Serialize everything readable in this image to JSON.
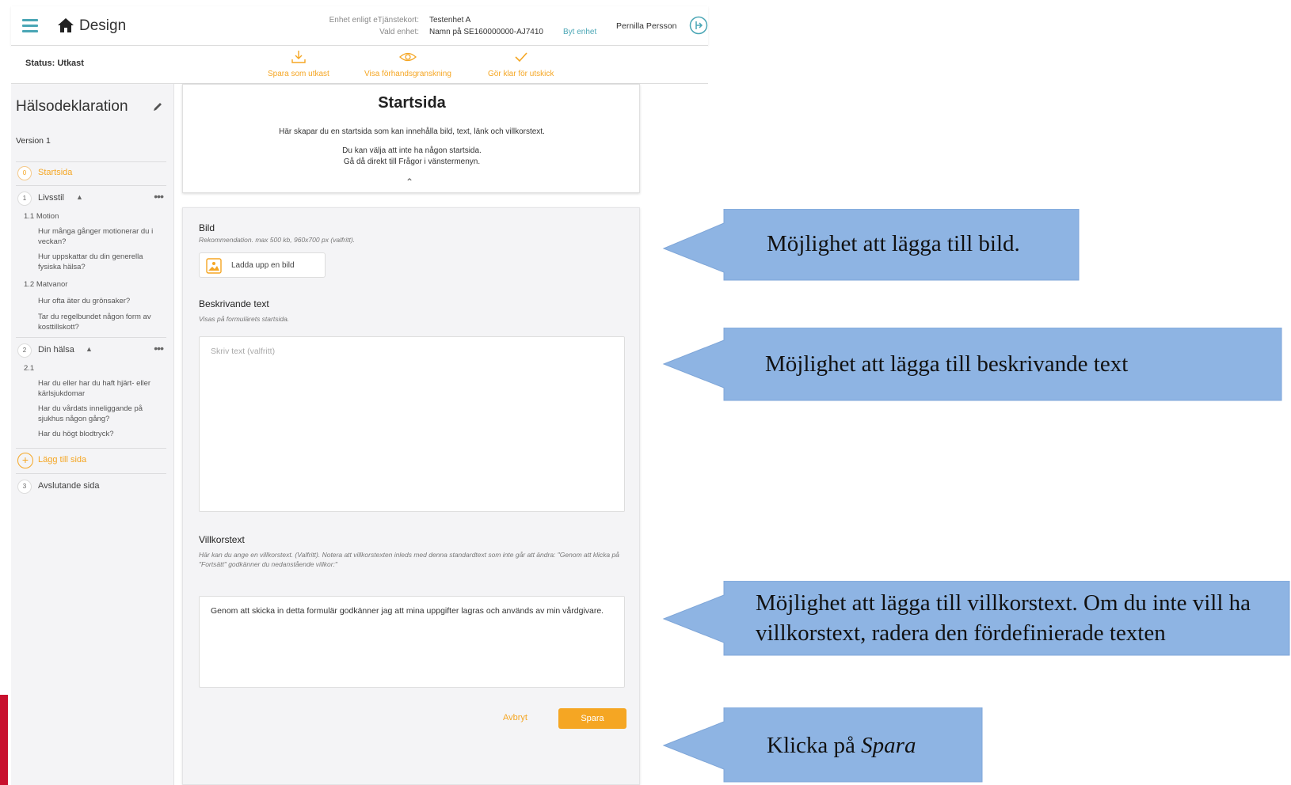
{
  "header": {
    "app_title": "Design",
    "unit_contract_label": "Enhet enligt eTjänstekort:",
    "unit_contract_value": "Testenhet A",
    "selected_unit_label": "Vald enhet:",
    "selected_unit_value": "Namn på SE160000000-AJ7410",
    "change_unit": "Byt enhet",
    "user_name": "Pernilla Persson"
  },
  "statusbar": {
    "status": "Status: Utkast",
    "actions": [
      {
        "label": "Spara som utkast",
        "icon": "download-icon"
      },
      {
        "label": "Visa förhandsgranskning",
        "icon": "eye-icon"
      },
      {
        "label": "Gör klar för utskick",
        "icon": "checkmark-icon"
      }
    ]
  },
  "sidebar": {
    "form_title": "Hälsodeklaration",
    "version": "Version 1",
    "pages": [
      {
        "num": "0",
        "label": "Startsida"
      },
      {
        "num": "1",
        "label": "Livsstil"
      },
      {
        "num": "2",
        "label": "Din hälsa"
      },
      {
        "num": "3",
        "label": "Avslutande sida"
      }
    ],
    "section_1_1": "1.1 Motion",
    "q1": "Hur många gånger motionerar du i veckan?",
    "q2": "Hur uppskattar du din generella fysiska hälsa?",
    "section_1_2": "1.2 Matvanor",
    "q3": "Hur ofta äter du grönsaker?",
    "q4": "Tar du regelbundet någon form av kosttillskott?",
    "section_2_1": "2.1",
    "q5": "Har du eller har du haft hjärt- eller kärlsjukdomar",
    "q6": "Har du vårdats inneliggande på sjukhus någon gång?",
    "q7": "Har du högt blodtryck?",
    "add_page": "Lägg till sida",
    "more": "•••"
  },
  "start_card": {
    "title": "Startsida",
    "line1": "Här skapar du en startsida som kan innehålla bild, text, länk och villkorstext.",
    "line2": "Du kan välja att inte ha någon startsida.",
    "line3": "Gå då direkt till Frågor i vänstermenyn."
  },
  "edit_card": {
    "image_label": "Bild",
    "image_hint": "Rekommendation. max 500 kb, 960x700 px (valfritt).",
    "upload_label": "Ladda upp en bild",
    "desc_label": "Beskrivande text",
    "desc_hint": "Visas på formulärets startsida.",
    "desc_placeholder": "Skriv text (valfritt)",
    "terms_label": "Villkorstext",
    "terms_hint": "Här kan du ange en villkorstext. (Valfritt). Notera att villkorstexten inleds med denna standardtext som inte går att ändra: \"Genom att klicka på \"Fortsätt\" godkänner du nedanstående villkor:\"",
    "terms_value": "Genom att skicka in detta formulär godkänner jag att mina uppgifter lagras och används av min vårdgivare.",
    "cancel": "Avbryt",
    "save": "Spara"
  },
  "callouts": {
    "image": "Möjlighet att lägga till bild.",
    "desc": "Möjlighet att lägga till beskrivande text",
    "terms_line1": "Möjlighet att lägga till villkorstext. Om du inte vill ha",
    "terms_line2": "villkorstext, radera den fördefinierade texten",
    "save_prefix": "Klicka på ",
    "save_word": "Spara"
  },
  "colors": {
    "accent": "#f5a623",
    "teal": "#4aa6b5",
    "callout_fill": "#8eb4e3"
  }
}
